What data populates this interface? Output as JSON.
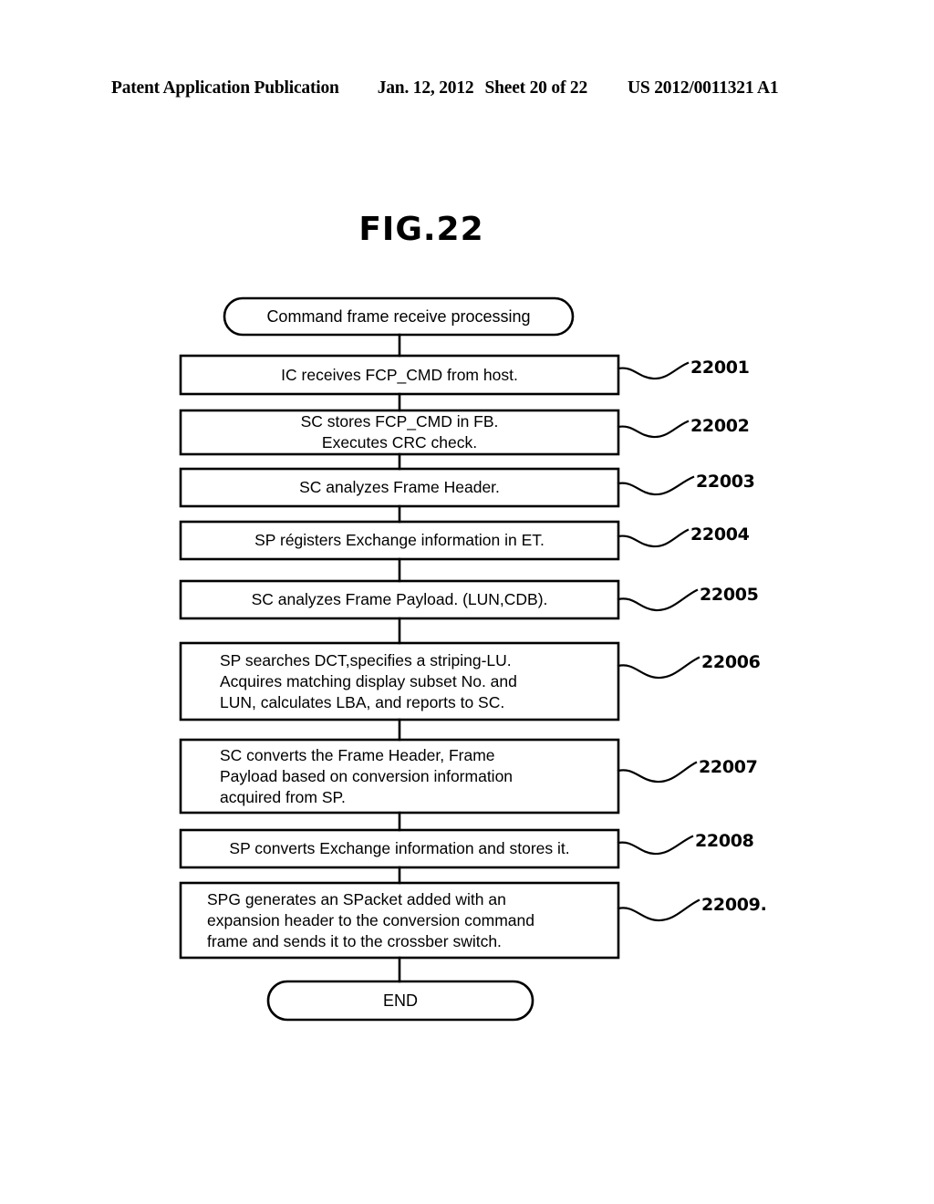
{
  "header": {
    "publication": "Patent Application Publication",
    "date": "Jan. 12, 2012",
    "sheet": "Sheet 20 of 22",
    "number": "US 2012/0011321 A1"
  },
  "figure": {
    "title": "FIG.22"
  },
  "flowchart": {
    "start_label": "Command frame receive processing",
    "end_label": "END",
    "steps": [
      {
        "ref": "22001",
        "text": "IC receives FCP_CMD from host.",
        "align": "center"
      },
      {
        "ref": "22002",
        "text": "SC stores FCP_CMD in FB.\nExecutes CRC check.",
        "align": "center"
      },
      {
        "ref": "22003",
        "text": "SC analyzes Frame Header.",
        "align": "center"
      },
      {
        "ref": "22004",
        "text": "SP régisters Exchange information in ET.",
        "align": "center"
      },
      {
        "ref": "22005",
        "text": "SC analyzes Frame Payload. (LUN,CDB).",
        "align": "center"
      },
      {
        "ref": "22006",
        "text": "SP searches DCT,specifies a striping-LU.\nAcquires matching display subset No. and\nLUN, calculates LBA, and reports to SC.",
        "align": "left"
      },
      {
        "ref": "22007",
        "text": "SC converts the Frame Header, Frame\nPayload based on conversion information\nacquired from SP.",
        "align": "left"
      },
      {
        "ref": "22008",
        "text": "SP converts Exchange information and stores it.",
        "align": "center"
      },
      {
        "ref": "22009.",
        "text": "SPG generates an SPacket added with an\nexpansion header to the conversion command\nframe and sends it to the crossber switch.",
        "align": "left"
      }
    ]
  },
  "colors": {
    "ink": "#000000",
    "paper": "#ffffff"
  }
}
